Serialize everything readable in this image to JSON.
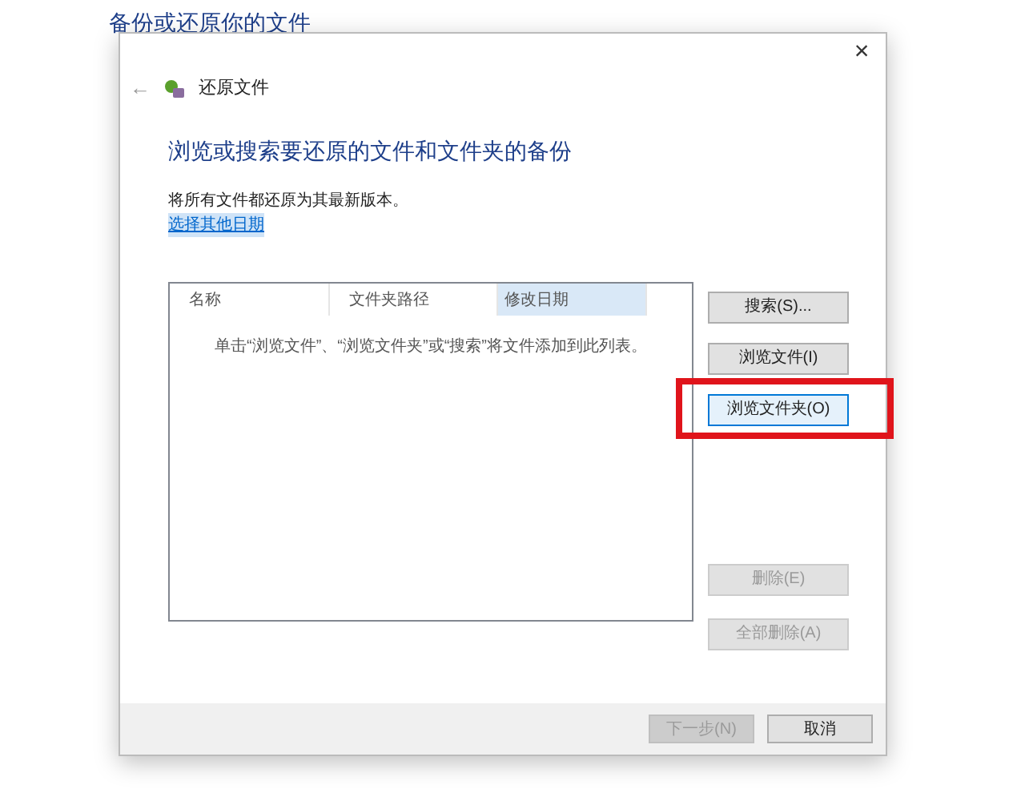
{
  "background_window": {
    "title": "备份或还原你的文件"
  },
  "dialog": {
    "close": "×",
    "back": "←",
    "title": "还原文件",
    "heading": "浏览或搜索要还原的文件和文件夹的备份",
    "description": "将所有文件都还原为其最新版本。",
    "link": "选择其他日期",
    "list": {
      "columns": [
        {
          "label": "名称",
          "selected": false
        },
        {
          "label": "文件夹路径",
          "selected": false
        },
        {
          "label": "修改日期",
          "selected": true
        }
      ],
      "empty_message": "单击“浏览文件”、“浏览文件夹”或“搜索”将文件添加到此列表。"
    },
    "side_buttons": [
      {
        "label": "搜索(S)...",
        "disabled": false,
        "focused": false,
        "highlighted": false
      },
      {
        "label": "浏览文件(I)",
        "disabled": false,
        "focused": false,
        "highlighted": false
      },
      {
        "label": "浏览文件夹(O)",
        "disabled": false,
        "focused": true,
        "highlighted": true
      },
      {
        "label": "删除(E)",
        "disabled": true,
        "focused": false,
        "highlighted": false
      },
      {
        "label": "全部删除(A)",
        "disabled": true,
        "focused": false,
        "highlighted": false
      }
    ],
    "footer_buttons": [
      {
        "label": "下一步(N)",
        "disabled": true
      },
      {
        "label": "取消",
        "disabled": false
      }
    ]
  }
}
